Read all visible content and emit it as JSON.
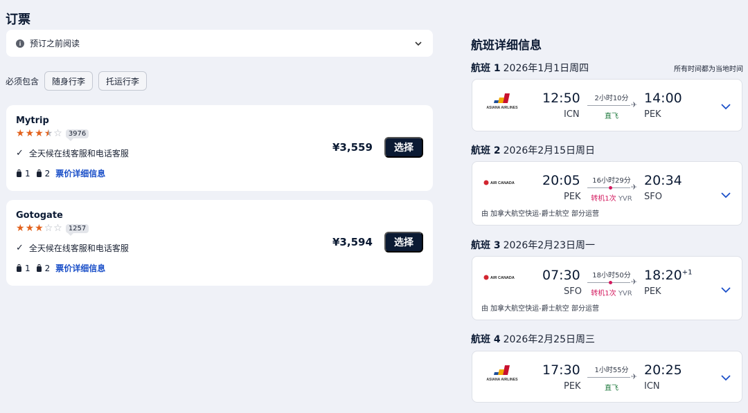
{
  "page_title": "订票",
  "notice": {
    "text": "预订之前阅读",
    "icon": "info-icon"
  },
  "includes": {
    "label": "必须包含",
    "options": [
      "随身行李",
      "托运行李"
    ]
  },
  "offers": [
    {
      "name": "Mytrip",
      "rating": 3.5,
      "reviews": "3976",
      "service": "全天候在线客服和电话客服",
      "carry_on": "1",
      "checked": "2",
      "fare_link": "票价详细信息",
      "price": "¥3,559",
      "select_label": "选择"
    },
    {
      "name": "Gotogate",
      "rating": 3,
      "reviews": "1257",
      "service": "全天候在线客服和电话客服",
      "carry_on": "1",
      "checked": "2",
      "fare_link": "票价详细信息",
      "price": "¥3,594",
      "select_label": "选择"
    }
  ],
  "details": {
    "title": "航班详细信息",
    "local_time_note": "所有时间都为当地时间",
    "segments": [
      {
        "label": "航班 1",
        "date": "2026年1月1日周四",
        "airline": "ASIANA AIRLINES",
        "dep_time": "12:50",
        "dep_code": "ICN",
        "arr_time": "14:00",
        "arr_code": "PEK",
        "plus_day": "",
        "duration": "2小时10分",
        "stops": "直飞",
        "stop_airport": "",
        "operated_by": ""
      },
      {
        "label": "航班 2",
        "date": "2026年2月15日周日",
        "airline": "AIR CANADA",
        "dep_time": "20:05",
        "dep_code": "PEK",
        "arr_time": "20:34",
        "arr_code": "SFO",
        "plus_day": "",
        "duration": "16小时29分",
        "stops": "转机1次",
        "stop_airport": "YVR",
        "operated_by": "由 加拿大航空快运-爵士航空 部分运营"
      },
      {
        "label": "航班 3",
        "date": "2026年2月23日周一",
        "airline": "AIR CANADA",
        "dep_time": "07:30",
        "dep_code": "SFO",
        "arr_time": "18:20",
        "arr_code": "PEK",
        "plus_day": "+1",
        "duration": "18小时50分",
        "stops": "转机1次",
        "stop_airport": "YVR",
        "operated_by": "由 加拿大航空快运-爵士航空 部分运营"
      },
      {
        "label": "航班 4",
        "date": "2026年2月25日周三",
        "airline": "ASIANA AIRLINES",
        "dep_time": "17:30",
        "dep_code": "PEK",
        "arr_time": "20:25",
        "arr_code": "ICN",
        "plus_day": "",
        "duration": "1小时55分",
        "stops": "直飞",
        "stop_airport": "",
        "operated_by": ""
      }
    ]
  },
  "colors": {
    "primary_button": "#0b1a33",
    "link": "#1a4fc8",
    "star": "#e2621d",
    "transfer": "#d3195e",
    "direct": "#1f7a3e"
  }
}
